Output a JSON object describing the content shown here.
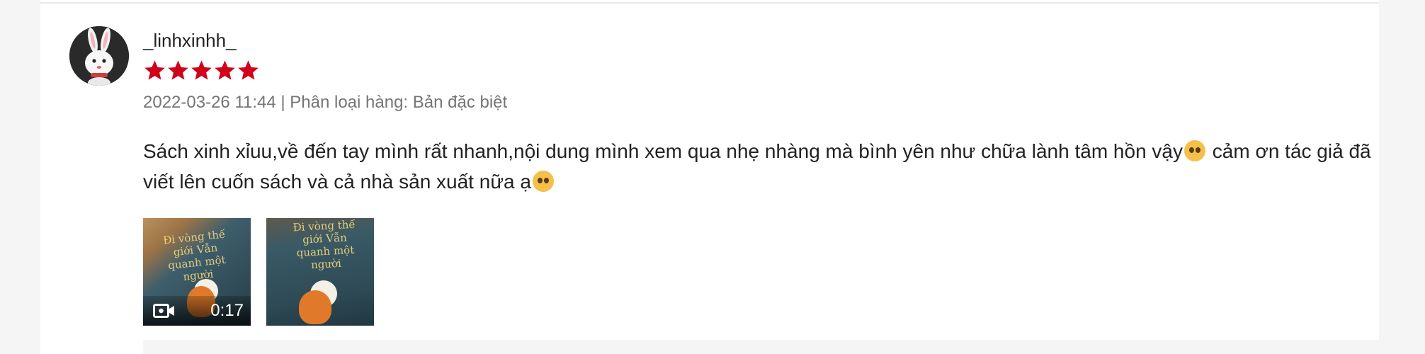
{
  "review": {
    "username": "_linhxinhh_",
    "rating": 5,
    "meta": "2022-03-26 11:44 | Phân loại hàng: Bản đặc biệt",
    "comment_part1": "Sách xinh xỉuu,về đến tay mình rất nhanh,nội dung mình xem qua nhẹ nhàng mà bình yên như chữa lành tâm hồn vậy",
    "comment_part2": " cảm ơn tác giả đã viết lên cuốn sách và cả nhà sản xuất nữa ạ",
    "media": [
      {
        "type": "video",
        "duration": "0:17",
        "cover_text": "Đi vòng thế giới Vẫn quanh một người"
      },
      {
        "type": "image",
        "cover_text": "Đi vòng thế giới Vẫn quanh một người"
      }
    ]
  },
  "colors": {
    "star": "#d0011b",
    "meta_text": "#757575",
    "text": "#222222"
  },
  "icons": {
    "rating": "star-icon",
    "video": "video-camera-icon",
    "emoji": "pleading-face-emoji-icon"
  }
}
